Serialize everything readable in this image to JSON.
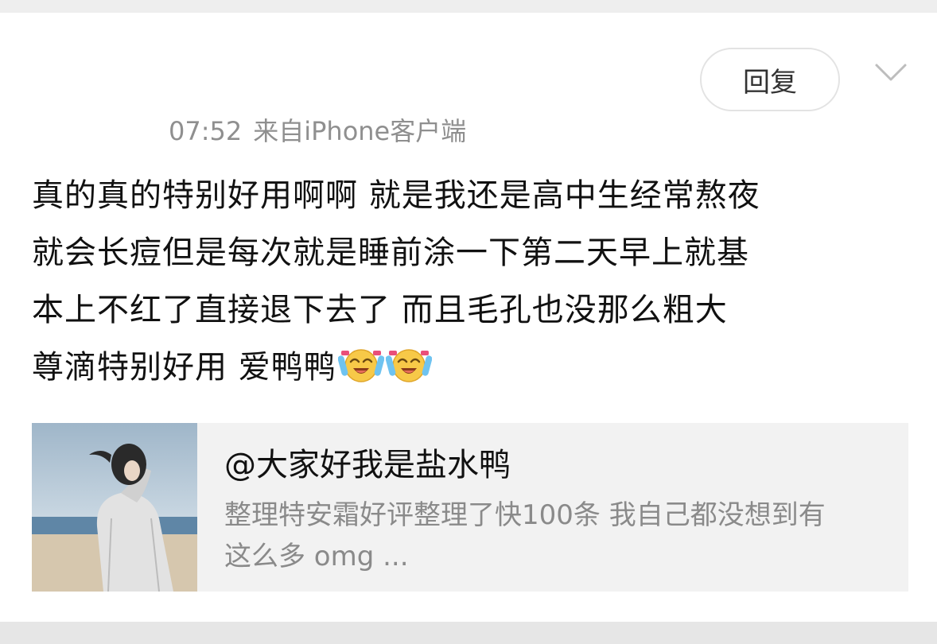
{
  "post": {
    "reply_label": "回复",
    "time": "07:52",
    "source": "来自iPhone客户端",
    "lines": [
      "真的真的特别好用啊啊 就是我还是高中生经常熬夜",
      "就会长痘但是每次就是睡前涂一下第二天早上就基",
      "本上不红了直接退下去了 而且毛孔也没那么粗大",
      "尊滴特别好用 爱鸭鸭"
    ],
    "emojis": [
      "laugh-cry-emoji",
      "laugh-cry-emoji"
    ]
  },
  "quote": {
    "username": "@大家好我是盐水鸭",
    "snippet_lines": [
      "整理特安霜好评整理了快100条 我自己都没想到有",
      "这么多 omg ..."
    ]
  },
  "colors": {
    "page_bg": "#ececec",
    "card_bg": "#ffffff",
    "meta_text": "#8f8f8f",
    "quote_bg": "#f2f2f2",
    "snippet_text": "#8a8a8a"
  }
}
